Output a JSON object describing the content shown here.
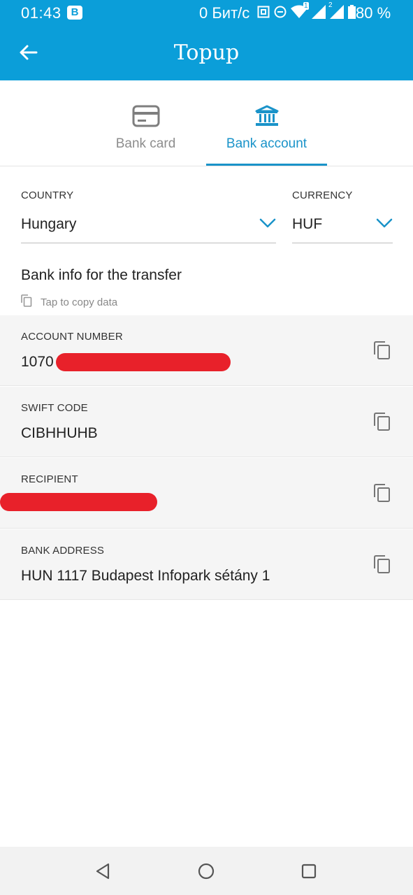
{
  "status_bar": {
    "time": "01:43",
    "badge": "B",
    "net_speed": "0 Бит/с",
    "sim1_label": "1",
    "sim2_label": "2",
    "battery_percent": "80 %",
    "icons": [
      "vpn-key-icon",
      "dnd-icon",
      "wifi-icon",
      "signal-sim1-icon",
      "signal-sim2-icon",
      "battery-icon"
    ]
  },
  "appbar": {
    "title": "Topup",
    "back_icon": "arrow-left-icon"
  },
  "tabs": [
    {
      "label": "Bank card",
      "icon": "credit-card-icon",
      "active": false
    },
    {
      "label": "Bank account",
      "icon": "bank-building-icon",
      "active": true
    }
  ],
  "country": {
    "label": "COUNTRY",
    "value": "Hungary"
  },
  "currency": {
    "label": "CURRENCY",
    "value": "HUF"
  },
  "bank_info": {
    "title": "Bank info for the transfer",
    "copy_hint": "Tap to copy data"
  },
  "rows": [
    {
      "label": "ACCOUNT NUMBER",
      "value": "1070"
    },
    {
      "label": "SWIFT CODE",
      "value": "CIBHHUHB"
    },
    {
      "label": "RECIPIENT",
      "value": ""
    },
    {
      "label": "BANK ADDRESS",
      "value": "HUN 1117 Budapest Infopark sétány 1"
    }
  ],
  "colors": {
    "primary": "#0b9ed9",
    "accent": "#1a93c9",
    "redaction": "#e8212a",
    "row_background": "#f5f5f5"
  }
}
